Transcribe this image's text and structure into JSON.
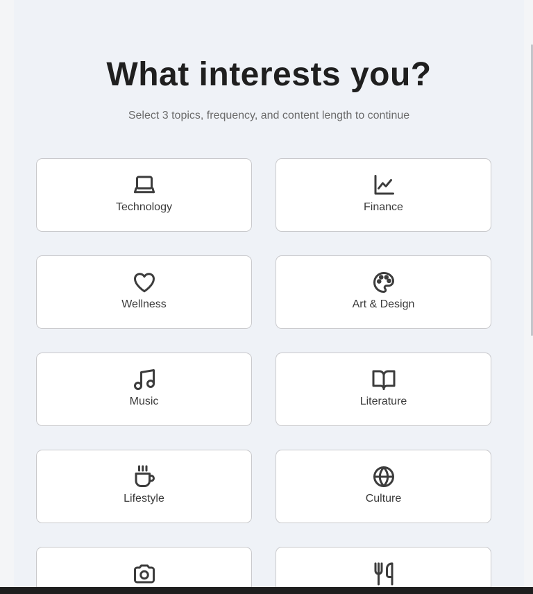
{
  "heading": "What interests you?",
  "subheading": "Select 3 topics, frequency, and content length to continue",
  "topics": [
    {
      "label": "Technology",
      "icon": "laptop-icon"
    },
    {
      "label": "Finance",
      "icon": "chart-line-icon"
    },
    {
      "label": "Wellness",
      "icon": "heart-icon"
    },
    {
      "label": "Art & Design",
      "icon": "palette-icon"
    },
    {
      "label": "Music",
      "icon": "music-note-icon"
    },
    {
      "label": "Literature",
      "icon": "open-book-icon"
    },
    {
      "label": "Lifestyle",
      "icon": "coffee-cup-icon"
    },
    {
      "label": "Culture",
      "icon": "globe-icon"
    },
    {
      "label": "",
      "icon": "camera-icon"
    },
    {
      "label": "",
      "icon": "fork-knife-icon"
    }
  ],
  "colors": {
    "page_bg": "#eff2f7",
    "card_border": "#c9c9cc",
    "icon": "#3c3c3c"
  }
}
